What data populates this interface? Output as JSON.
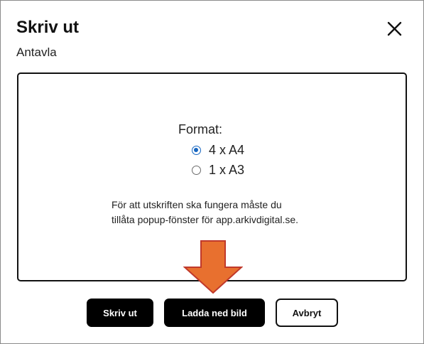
{
  "dialog": {
    "title": "Skriv ut",
    "subtitle": "Antavla",
    "close_icon": "close-icon"
  },
  "format": {
    "label": "Format:",
    "options": [
      {
        "label": "4 x A4",
        "selected": true
      },
      {
        "label": "1 x A3",
        "selected": false
      }
    ]
  },
  "note": "För att utskriften ska fungera måste du tillåta popup-fönster för app.arkivdigital.se.",
  "buttons": {
    "print": "Skriv ut",
    "download": "Ladda ned bild",
    "cancel": "Avbryt"
  },
  "annotation": {
    "icon": "arrow-down-icon",
    "color": "#e8702f"
  },
  "colors": {
    "radio_accent": "#1565c0",
    "primary_button": "#000000"
  }
}
